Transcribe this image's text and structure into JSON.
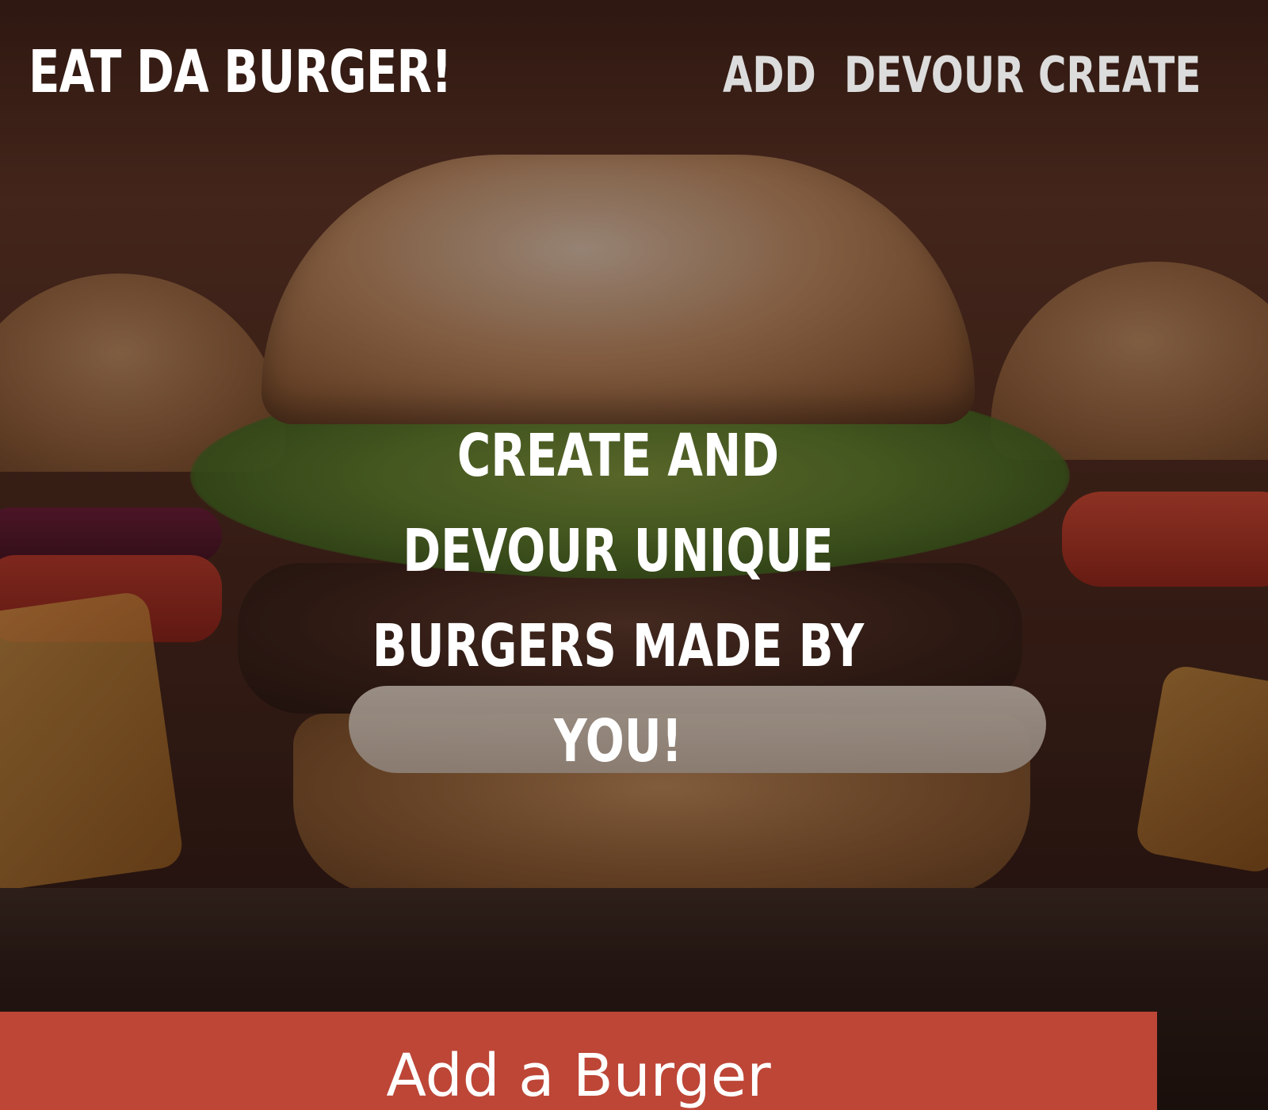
{
  "navbar": {
    "brand": "EAT DA BURGER!",
    "links": [
      {
        "label": "ADD"
      },
      {
        "label": "DEVOUR"
      },
      {
        "label": "CREATE"
      }
    ]
  },
  "hero": {
    "heading": "CREATE AND DEVOUR UNIQUE BURGERS MADE BY YOU!",
    "background_image": "burger-photo"
  },
  "add_section": {
    "title": "Add a Burger"
  },
  "colors": {
    "accent": "#bd4637",
    "nav_text": "#dcdcdc",
    "brand_text": "#ffffff"
  }
}
